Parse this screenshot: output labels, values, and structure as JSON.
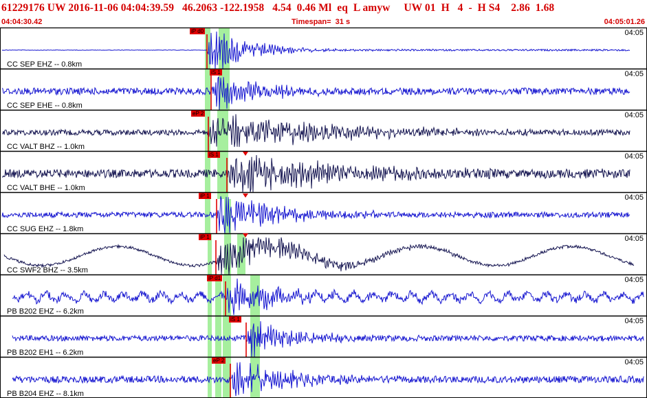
{
  "header": {
    "title": "61229176 UW 2016-11-06 04:04:39.59   46.2063 -122.1958   4.54  0.46 Ml  eq  L amyw     UW 01  H   4  -  H S4    2.86  1.68",
    "start_time": "04:04:30.42",
    "timespan": "Timespan=  31 s",
    "end_time": "04:05:01.26"
  },
  "colors": {
    "title": "#d40000",
    "trace_blue": "#1515d0",
    "trace_navy": "#141450",
    "pick": "#e00000",
    "highlight": "#a6ef9e",
    "separator": "#000000"
  },
  "channels": [
    {
      "label": "CC SEP EHZ -- 0.8km",
      "time_tick": "04:05",
      "pick_label": "iP d0",
      "trace_color": "blue"
    },
    {
      "label": "CC SEP EHE -- 0.8km",
      "time_tick": "04:05",
      "pick_label": "iS 1",
      "trace_color": "blue"
    },
    {
      "label": "CC VALT BHZ -- 1.0km",
      "time_tick": "04:05",
      "pick_label": "eP 2",
      "trace_color": "navy"
    },
    {
      "label": "CC VALT BHE -- 1.0km",
      "time_tick": "04:05",
      "pick_label": "iS 1",
      "trace_color": "navy"
    },
    {
      "label": "CC SUG EHZ -- 1.8km",
      "time_tick": "04:05",
      "pick_label": "iP 1",
      "trace_color": "blue"
    },
    {
      "label": "CC SWF2 BHZ -- 3.5km",
      "time_tick": "04:05",
      "pick_label": "iP 1",
      "trace_color": "navy"
    },
    {
      "label": "PB B202 EHZ -- 6.2km",
      "time_tick": "04:05",
      "pick_label": "iP d1",
      "trace_color": "blue"
    },
    {
      "label": "PB B202 EH1 -- 6.2km",
      "time_tick": "04:05",
      "pick_label": "iS 1",
      "trace_color": "blue"
    },
    {
      "label": "PB B204 EHZ -- 8.1km",
      "time_tick": "04:05",
      "pick_label": "eP 2",
      "trace_color": "blue"
    }
  ]
}
